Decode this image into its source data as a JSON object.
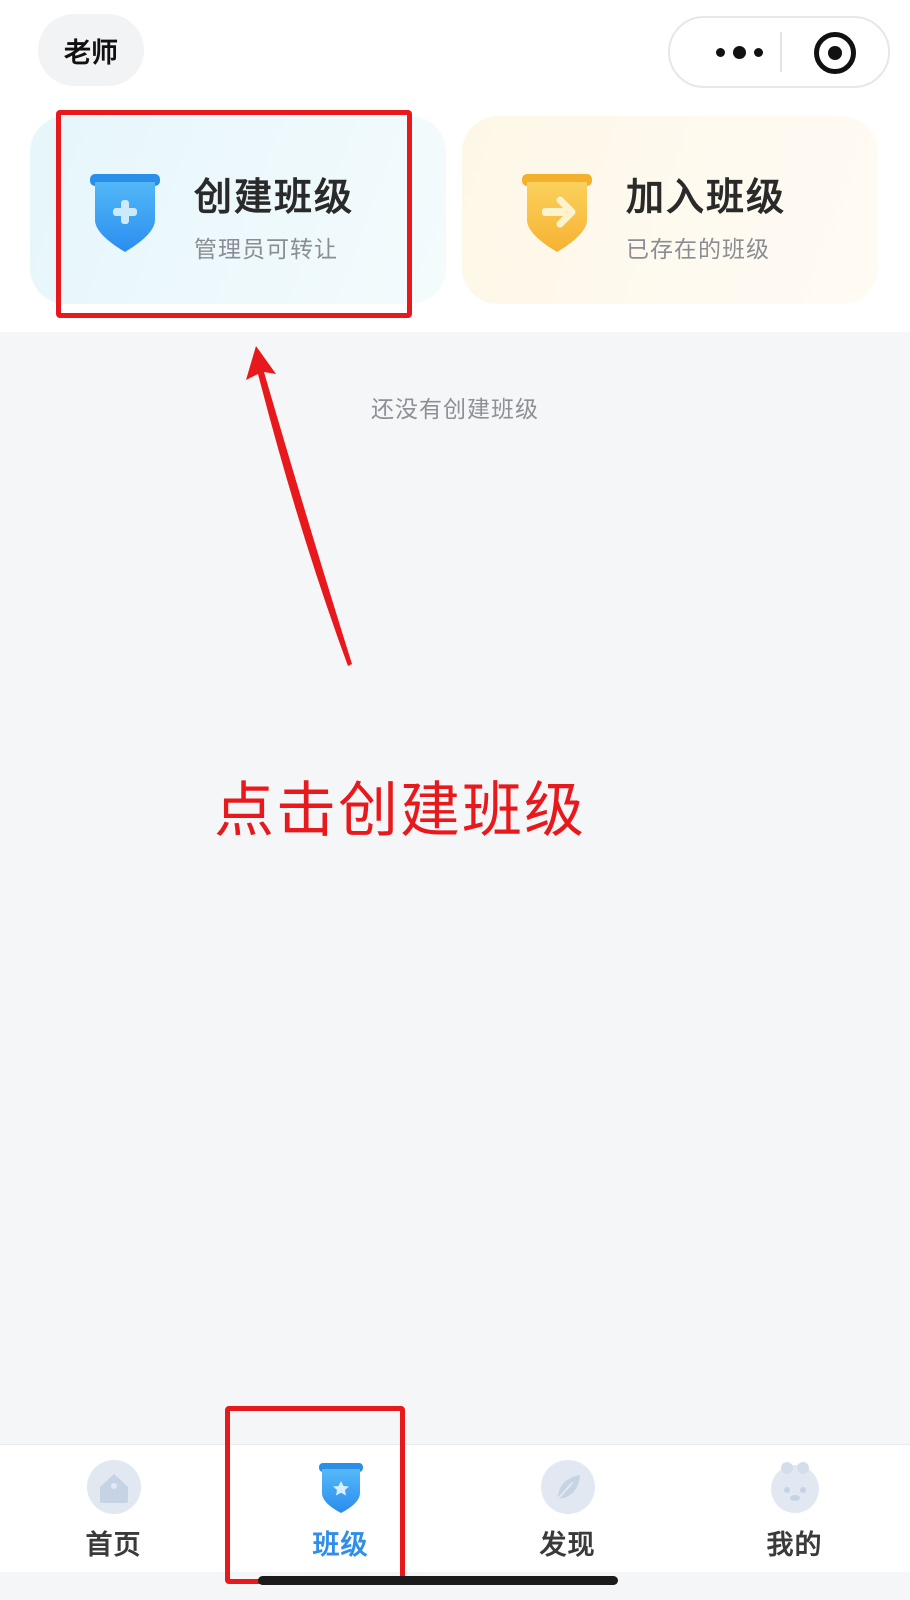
{
  "header": {
    "role_label": "老师",
    "menu_icon": "more-dots-icon",
    "close_icon": "target-circle-icon"
  },
  "cards": {
    "create": {
      "title": "创建班级",
      "subtitle": "管理员可转让",
      "icon": "shield-plus-icon"
    },
    "join": {
      "title": "加入班级",
      "subtitle": "已存在的班级",
      "icon": "shield-arrow-icon"
    }
  },
  "main": {
    "empty_text": "还没有创建班级"
  },
  "annotation": {
    "instruction": "点击创建班级"
  },
  "tabbar": {
    "items": [
      {
        "label": "首页",
        "icon": "home-icon",
        "active": false
      },
      {
        "label": "班级",
        "icon": "class-shield-icon",
        "active": true
      },
      {
        "label": "发现",
        "icon": "discover-leaf-icon",
        "active": false
      },
      {
        "label": "我的",
        "icon": "profile-avatar-icon",
        "active": false
      }
    ]
  },
  "colors": {
    "accent": "#2f8fe8",
    "annotation": "#e8191c",
    "create_badge": "#3a9ff0",
    "join_badge": "#f7be3c"
  }
}
